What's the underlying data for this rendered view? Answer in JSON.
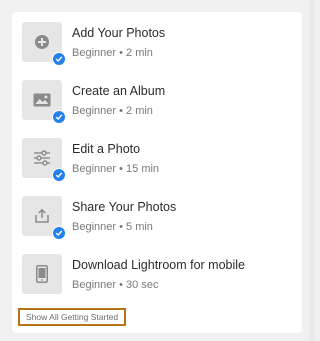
{
  "tasks": [
    {
      "title": "Add Your Photos",
      "level": "Beginner",
      "duration": "2 min",
      "icon": "plus-circle-icon",
      "completed": true
    },
    {
      "title": "Create an Album",
      "level": "Beginner",
      "duration": "2 min",
      "icon": "image-icon",
      "completed": true
    },
    {
      "title": "Edit a Photo",
      "level": "Beginner",
      "duration": "15 min",
      "icon": "sliders-icon",
      "completed": true
    },
    {
      "title": "Share Your Photos",
      "level": "Beginner",
      "duration": "5 min",
      "icon": "share-icon",
      "completed": true
    },
    {
      "title": "Download Lightroom for mobile",
      "level": "Beginner",
      "duration": "30 sec",
      "icon": "phone-icon",
      "completed": false
    }
  ],
  "meta_separator": "•",
  "show_all_label": "Show All Getting Started",
  "colors": {
    "check": "#2680eb",
    "focus_border": "#b8731a"
  }
}
